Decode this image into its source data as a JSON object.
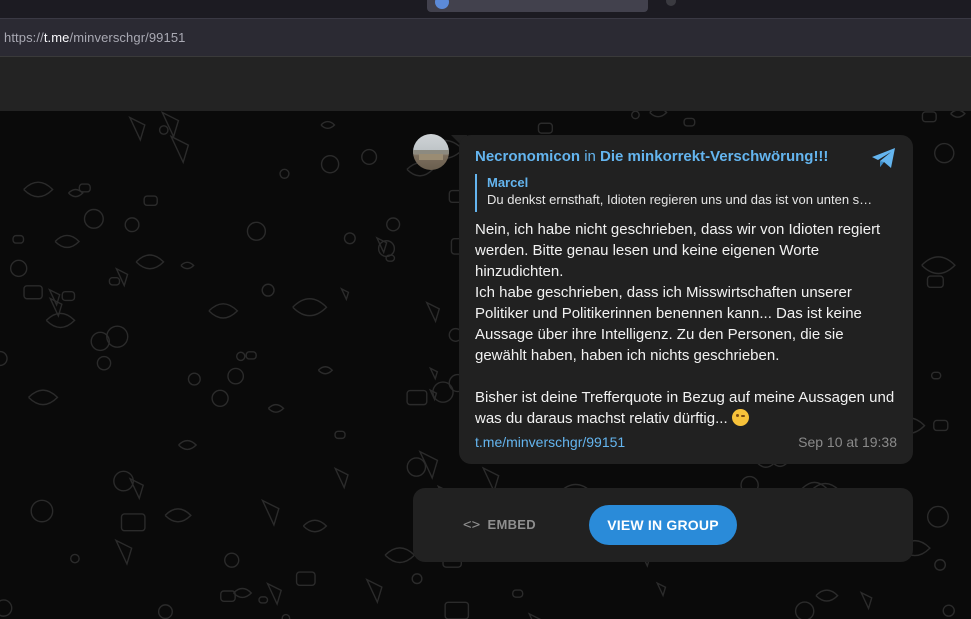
{
  "browser": {
    "url_prefix": "https://",
    "url_host": "t.me",
    "url_path": "/minverschgr/99151"
  },
  "message": {
    "author": "Necronomicon",
    "in_word": "in",
    "group": "Die minkorrekt-Verschwörung!!!",
    "reply": {
      "name": "Marcel",
      "text": "Du denkst ernsthaft, Idioten regieren uns und das ist von unten s…"
    },
    "text_p1": "Nein, ich habe nicht geschrieben, dass wir von Idioten regiert werden. Bitte genau lesen und keine eigenen Worte hinzudichten.",
    "text_p2": "Ich habe geschrieben, dass ich Misswirtschaften unserer Politiker und Politikerinnen benennen kann... Das ist keine Aussage über ihre Intelligenz. Zu den Personen, die sie gewählt haben, haben ich nichts geschrieben.",
    "text_p3": "Bisher ist deine Trefferquote in Bezug auf meine Aussagen und was du daraus machst relativ dürftig...",
    "emoji": "winking-face",
    "link": "t.me/minverschgr/99151",
    "time": "Sep 10 at 19:38"
  },
  "actions": {
    "embed_label": "EMBED",
    "view_label": "VIEW IN GROUP"
  },
  "colors": {
    "accent": "#64b5ef",
    "button": "#2a8bd9",
    "bubble": "#212121",
    "background": "#0a0a0a"
  }
}
